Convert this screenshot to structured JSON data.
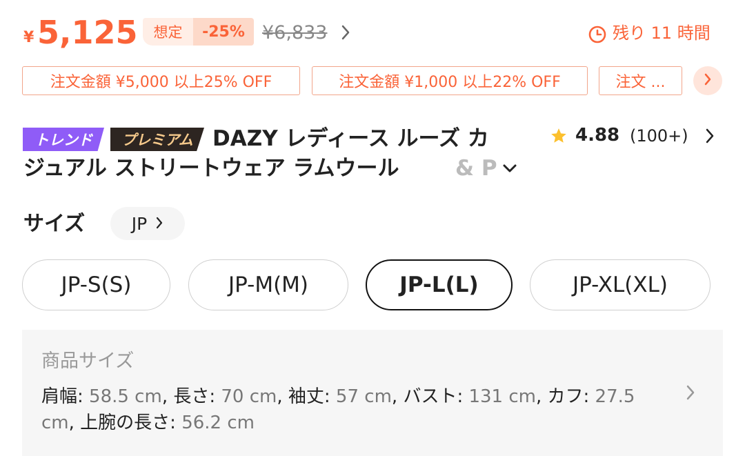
{
  "price": {
    "currency_symbol": "¥",
    "current": "5,125",
    "estimate_label": "想定",
    "discount": "-25%",
    "original": "¥6,833"
  },
  "timer": {
    "text": "残り 11 時間"
  },
  "coupons": [
    "注文金額 ¥5,000 以上25% OFF",
    "注文金額 ¥1,000 以上22% OFF",
    "注文 ..."
  ],
  "tags": {
    "trend": "トレンド",
    "premium": "プレミアム"
  },
  "title": {
    "line1": "DAZY レディース ルーズ カ",
    "line2": "ジュアル ストリートウェア ラムウール",
    "line2_fade": "& P"
  },
  "rating": {
    "value": "4.88",
    "count": "(100+)"
  },
  "size": {
    "label": "サイズ",
    "unit": "JP",
    "options": [
      "JP-S(S)",
      "JP-M(M)",
      "JP-L(L)",
      "JP-XL(XL)"
    ],
    "selected": "JP-L(L)"
  },
  "product_size": {
    "title": "商品サイズ",
    "items": [
      {
        "label": "肩幅: ",
        "value": "58.5 cm",
        "sep": ", "
      },
      {
        "label": "長さ: ",
        "value": "70 cm",
        "sep": ", "
      },
      {
        "label": "袖丈: ",
        "value": "57 cm",
        "sep": ", "
      },
      {
        "label": "バスト: ",
        "value": "131 cm",
        "sep": ", "
      },
      {
        "label": "カフ: ",
        "value": "27.5 cm",
        "sep": ", "
      },
      {
        "label": "上腕の長さ: ",
        "value": "56.2 cm",
        "sep": ""
      }
    ]
  },
  "colors": {
    "accent": "#fa6338",
    "trend_tag": "#8f5cf7",
    "premium_tag": "#2d2521"
  }
}
